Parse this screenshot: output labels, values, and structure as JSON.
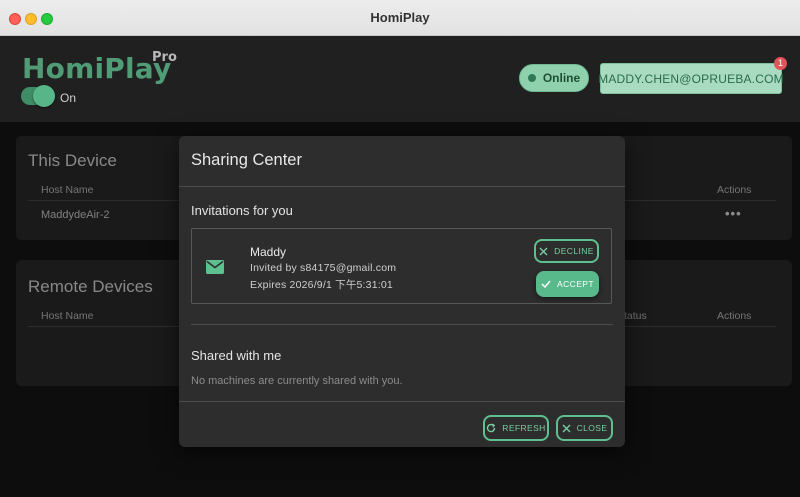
{
  "window": {
    "title": "HomiPlay"
  },
  "header": {
    "logo": "HomiPlay",
    "logo_badge": "Pro",
    "toggle_label": "On",
    "status": "Online",
    "user_email": "MADDY.CHEN@OPRUEBA.COM",
    "notification_count": "1"
  },
  "this_device": {
    "title": "This Device",
    "columns": {
      "host": "Host Name",
      "actions": "Actions"
    },
    "rows": [
      {
        "host": "MaddydeAir-2",
        "actions_icon": "more-icon"
      }
    ]
  },
  "remote_devices": {
    "title": "Remote Devices",
    "columns": {
      "host": "Host Name",
      "status": "Status",
      "actions": "Actions"
    }
  },
  "modal": {
    "title": "Sharing Center",
    "invitations_title": "Invitations for you",
    "invitation": {
      "icon": "mail-icon",
      "name": "Maddy",
      "invited_by": "Invited by s84175@gmail.com",
      "expires": "Expires 2026/9/1 下午5:31:01",
      "decline_label": "DECLINE",
      "accept_label": "ACCEPT"
    },
    "shared_title": "Shared with me",
    "shared_empty": "No machines are currently shared with you.",
    "refresh_label": "REFRESH",
    "close_label": "CLOSE"
  },
  "colors": {
    "accent": "#58b98a",
    "accent_outline": "#5fbf8e",
    "logo": "#4f9c76",
    "online_pill": "#8fd1ad",
    "badge": "#e0555a"
  }
}
